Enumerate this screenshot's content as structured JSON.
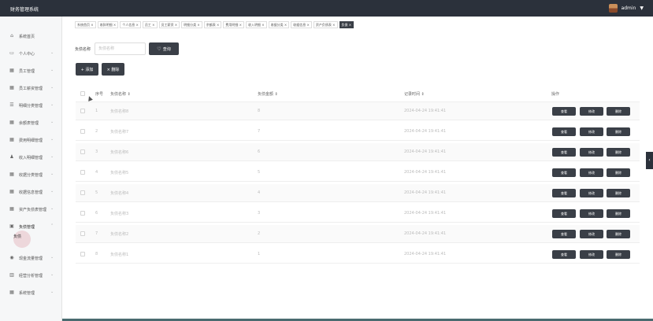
{
  "app": {
    "title": "财务管理系统"
  },
  "user": {
    "name": "admin",
    "caret": "▼"
  },
  "sidebar": {
    "items": [
      {
        "label": "系统首页",
        "icon": "home-icon",
        "glyph": "⌂",
        "chev": ""
      },
      {
        "label": "个人中心",
        "icon": "calendar-icon",
        "glyph": "▭",
        "chev": "⌄"
      },
      {
        "label": "员工管理",
        "icon": "grid-icon",
        "glyph": "▦",
        "chev": "⌄"
      },
      {
        "label": "员工薪资管理",
        "icon": "grid-icon",
        "glyph": "▦",
        "chev": "⌄"
      },
      {
        "label": "明细分类管理",
        "icon": "list-icon",
        "glyph": "☰",
        "chev": "⌄"
      },
      {
        "label": "余额表管理",
        "icon": "grid-icon",
        "glyph": "▦",
        "chev": "⌄"
      },
      {
        "label": "费用明细管理",
        "icon": "grid-icon",
        "glyph": "▦",
        "chev": "⌄"
      },
      {
        "label": "收入明细管理",
        "icon": "user-icon",
        "glyph": "♟",
        "chev": "⌄"
      },
      {
        "label": "收据分类管理",
        "icon": "grid-icon",
        "glyph": "▦",
        "chev": "⌄"
      },
      {
        "label": "收据信息管理",
        "icon": "grid-icon",
        "glyph": "▦",
        "chev": "⌄"
      },
      {
        "label": "资产负债表管理",
        "icon": "grid-icon",
        "glyph": "▦",
        "chev": "⌄"
      },
      {
        "label": "负债管理",
        "icon": "calendar-icon",
        "glyph": "▣",
        "chev": "⌃"
      },
      {
        "label": "现金流量管理",
        "icon": "coins-icon",
        "glyph": "◉",
        "chev": "⌄"
      },
      {
        "label": "经营分析管理",
        "icon": "bar-chart-icon",
        "glyph": "▥",
        "chev": "⌄"
      },
      {
        "label": "系统管理",
        "icon": "grid-icon",
        "glyph": "▦",
        "chev": "⌄"
      }
    ],
    "sub_item": "负债"
  },
  "tabs": [
    "系统首页 ×",
    "收款明细 ×",
    "个人信息 ×",
    "员工 ×",
    "员工薪资 ×",
    "明细分类 ×",
    "余额表 ×",
    "费用明细 ×",
    "收入明细 ×",
    "收据分类 ×",
    "收据信息 ×",
    "资产负债表 ×",
    "负债 ×"
  ],
  "search": {
    "label": "负债名称",
    "placeholder": "负债名称",
    "button": "查询",
    "button_icon": "heart-icon"
  },
  "toolbar": {
    "add": "+ 添加",
    "delete": "× 删除"
  },
  "table": {
    "headers": {
      "index": "序号",
      "name": "负债名称 ⇕",
      "amount": "负债金额 ⇕",
      "time": "记录时间 ⇕",
      "actions": "操作"
    },
    "rows": [
      {
        "index": "1",
        "name": "负债名称8",
        "amount": "8",
        "time": "2024-04-24 19:41:41"
      },
      {
        "index": "2",
        "name": "负债名称7",
        "amount": "7",
        "time": "2024-04-24 19:41:41"
      },
      {
        "index": "3",
        "name": "负债名称6",
        "amount": "6",
        "time": "2024-04-24 19:41:41"
      },
      {
        "index": "4",
        "name": "负债名称5",
        "amount": "5",
        "time": "2024-04-24 19:41:41"
      },
      {
        "index": "5",
        "name": "负债名称4",
        "amount": "4",
        "time": "2024-04-24 19:41:41"
      },
      {
        "index": "6",
        "name": "负债名称3",
        "amount": "3",
        "time": "2024-04-24 19:41:41"
      },
      {
        "index": "7",
        "name": "负债名称2",
        "amount": "2",
        "time": "2024-04-24 19:41:41"
      },
      {
        "index": "8",
        "name": "负债名称1",
        "amount": "1",
        "time": "2024-04-24 19:41:41"
      }
    ],
    "row_buttons": {
      "view": "查看",
      "edit": "修改",
      "delete": "删除"
    }
  },
  "side_handle": "‹",
  "colors": {
    "topbar": "#2b313b",
    "button": "#3a3f47",
    "sidebar": "#f6f7f8"
  }
}
